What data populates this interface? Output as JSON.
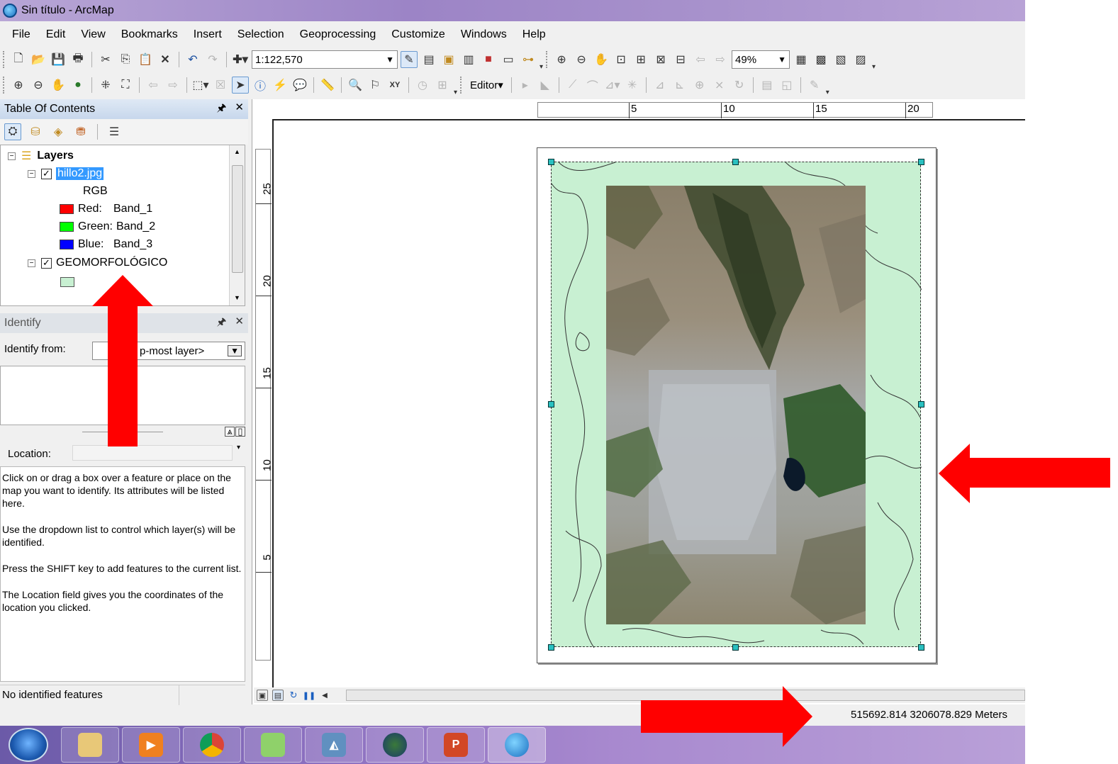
{
  "window": {
    "title": "Sin título - ArcMap"
  },
  "menu": [
    "File",
    "Edit",
    "View",
    "Bookmarks",
    "Insert",
    "Selection",
    "Geoprocessing",
    "Customize",
    "Windows",
    "Help"
  ],
  "toolbar1": {
    "scale": "1:122,570",
    "zoom": "49%"
  },
  "toolbar2": {
    "editor_label": "Editor▾"
  },
  "toc": {
    "title": "Table Of Contents",
    "root": "Layers",
    "layer1": {
      "name": "hillo2.jpg",
      "renderer": "RGB",
      "bands": [
        {
          "label": "Red:",
          "band": "Band_1",
          "color": "#ff0000"
        },
        {
          "label": "Green:",
          "band": "Band_2",
          "color": "#00ff00"
        },
        {
          "label": "Blue:",
          "band": "Band_3",
          "color": "#0000ff"
        }
      ]
    },
    "layer2": {
      "name": "GEOMORFOLÓGICO",
      "symbol_color": "#c8f0d2"
    }
  },
  "identify": {
    "title": "Identify",
    "from_label": "Identify from:",
    "from_value": "p-most layer>",
    "location_label": "Location:",
    "help": [
      "Click on or drag a box over a feature or place on the map you want to identify. Its attributes will be listed here.",
      "Use the dropdown list to control which layer(s) will be identified.",
      "Press the SHIFT key to add features to the current list.",
      "The Location field gives you the coordinates of the location you clicked."
    ],
    "status": "No identified features"
  },
  "rulers": {
    "h": [
      "5",
      "10",
      "15",
      "20"
    ],
    "v": [
      "25",
      "20",
      "15",
      "10",
      "5"
    ]
  },
  "statusbar": {
    "coords": "515692.814  3206078.829 Meters"
  },
  "colors": {
    "arrow": "#ff0000",
    "dataframe_fill": "#c8f0d2",
    "handle": "#2ac0c0"
  }
}
